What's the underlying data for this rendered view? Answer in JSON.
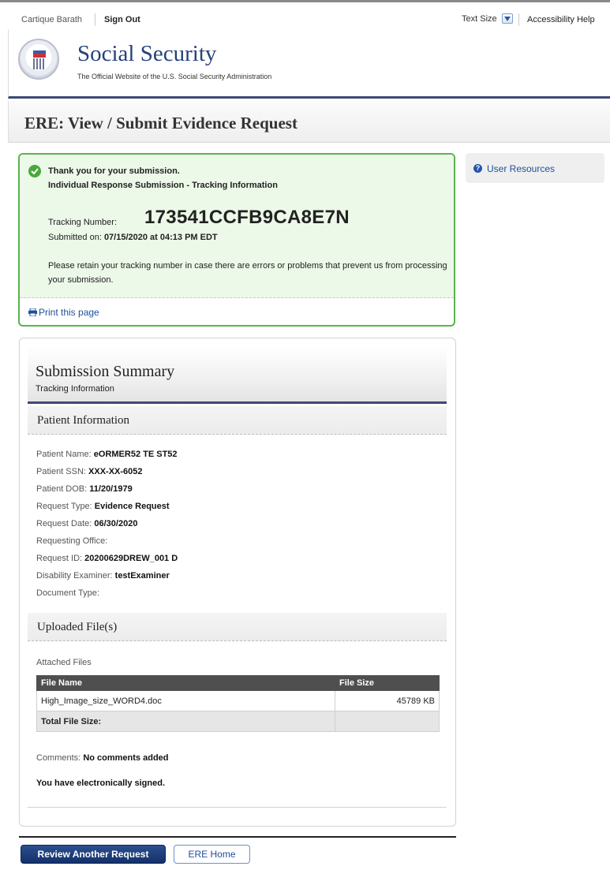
{
  "utility": {
    "username": "Cartique Barath",
    "sign_out": "Sign Out",
    "text_size": "Text Size",
    "accessibility_help": "Accessibility Help"
  },
  "header": {
    "brand_title": "Social Security",
    "brand_subtitle": "The Official Website of the U.S. Social Security Administration"
  },
  "page": {
    "title": "ERE: View / Submit Evidence Request"
  },
  "confirmation": {
    "thanks": "Thank you for your submission.",
    "subtitle": "Individual Response Submission - Tracking Information",
    "tracking_label": "Tracking Number:",
    "tracking_number": "173541CCFB9CA8E7N",
    "submitted_label": "Submitted on:",
    "submitted_value": "07/15/2020 at 04:13 PM EDT",
    "retain_message": "Please retain your tracking number in case there are errors or problems that prevent us from processing your submission.",
    "print_link": "Print this page"
  },
  "sidebar": {
    "user_resources": "User Resources"
  },
  "summary": {
    "title": "Submission Summary",
    "subtitle": "Tracking Information",
    "patient_section": "Patient Information",
    "fields": [
      {
        "label": "Patient Name:",
        "value": "eORMER52 TE ST52"
      },
      {
        "label": "Patient SSN:",
        "value": "XXX-XX-6052"
      },
      {
        "label": "Patient DOB:",
        "value": "11/20/1979"
      },
      {
        "label": "Request Type:",
        "value": "Evidence Request"
      },
      {
        "label": "Request Date:",
        "value": "06/30/2020"
      },
      {
        "label": "Requesting Office:",
        "value": ""
      },
      {
        "label": "Request ID:",
        "value": "20200629DREW_001 D"
      },
      {
        "label": "Disability Examiner:",
        "value": "testExaminer"
      },
      {
        "label": "Document Type:",
        "value": ""
      }
    ],
    "uploaded_section": "Uploaded File(s)",
    "attached_label": "Attached Files",
    "table_headers": [
      "File Name",
      "File Size"
    ],
    "files": [
      {
        "name": "High_Image_size_WORD4.doc",
        "size": "45789 KB"
      }
    ],
    "total_label": "Total File Size:",
    "total_value": "",
    "comments_label": "Comments:",
    "comments_value": "No comments added",
    "signed_text": "You have electronically signed."
  },
  "actions": {
    "review_another": "Review Another Request",
    "ere_home": "ERE Home"
  }
}
